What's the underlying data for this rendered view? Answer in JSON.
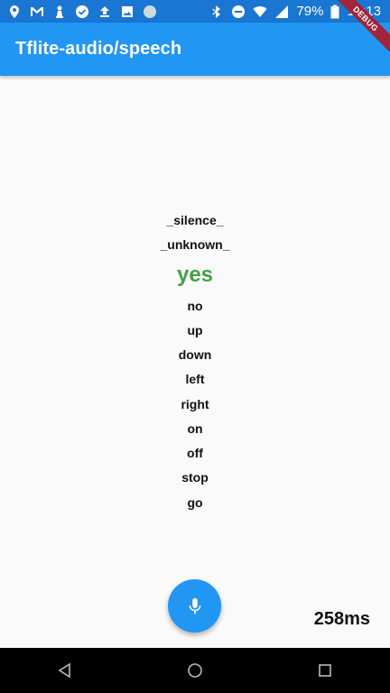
{
  "status_bar": {
    "battery": "79%",
    "time": "12:13",
    "left_icons": [
      "location-icon",
      "gmail-icon",
      "chess-icon",
      "check-circle-icon",
      "upload-icon",
      "image-icon",
      "circle-icon"
    ],
    "right_icons": [
      "bluetooth-icon",
      "do-not-disturb-icon",
      "wifi-icon",
      "signal-icon",
      "battery-icon"
    ]
  },
  "app_bar": {
    "title": "Tflite-audio/speech"
  },
  "debug_banner": "DEBUG",
  "labels": [
    {
      "text": "_silence_",
      "active": false
    },
    {
      "text": "_unknown_",
      "active": false
    },
    {
      "text": "yes",
      "active": true
    },
    {
      "text": "no",
      "active": false
    },
    {
      "text": "up",
      "active": false
    },
    {
      "text": "down",
      "active": false
    },
    {
      "text": "left",
      "active": false
    },
    {
      "text": "right",
      "active": false
    },
    {
      "text": "on",
      "active": false
    },
    {
      "text": "off",
      "active": false
    },
    {
      "text": "stop",
      "active": false
    },
    {
      "text": "go",
      "active": false
    }
  ],
  "inference_time": "258ms",
  "colors": {
    "primary": "#2196f3",
    "status_bar": "#1976d2",
    "active_label": "#43a047",
    "debug_banner": "#a0243a"
  },
  "fab_icon": "mic-icon",
  "nav": [
    "back-icon",
    "home-icon",
    "recents-icon"
  ]
}
